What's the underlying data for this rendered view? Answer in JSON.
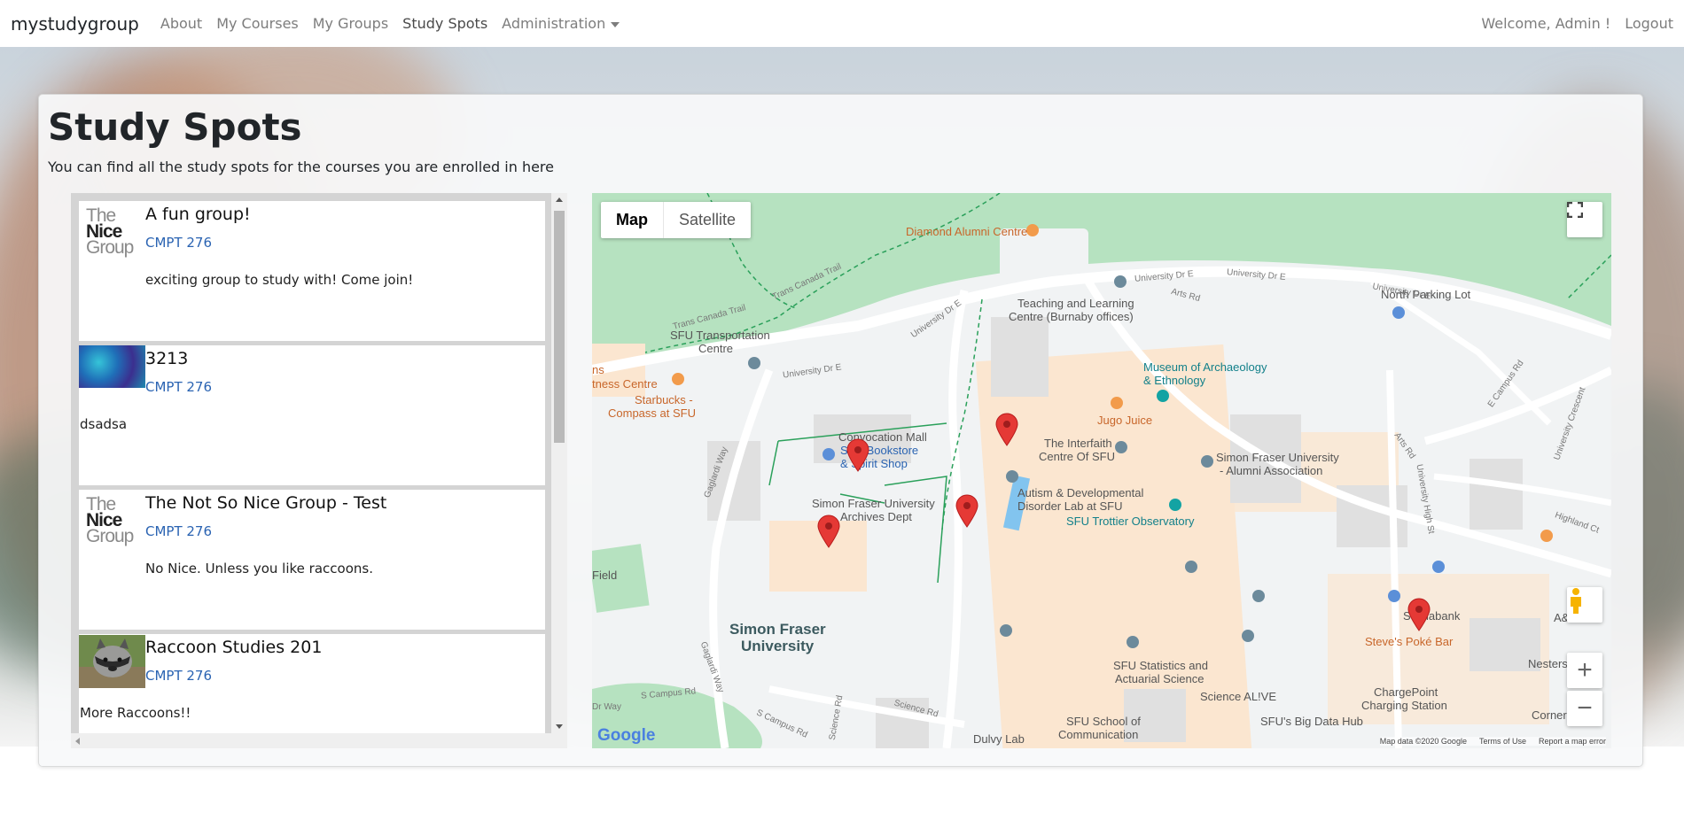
{
  "navbar": {
    "brand": "mystudygroup",
    "links": [
      "About",
      "My Courses",
      "My Groups",
      "Study Spots",
      "Administration"
    ],
    "welcome": "Welcome, Admin !",
    "logout": "Logout"
  },
  "page": {
    "title": "Study Spots",
    "subtitle": "You can find all the study spots for the courses you are enrolled in here"
  },
  "groups": [
    {
      "name": "A fun group!",
      "course": "CMPT 276",
      "description": "exciting group to study with! Come join!",
      "image": "the-nice-group-logo"
    },
    {
      "name": "3213",
      "course": "CMPT 276",
      "description": "dsadsa",
      "image": "blue-abstract-image"
    },
    {
      "name": "The Not So Nice Group - Test",
      "course": "CMPT 276",
      "description": "No Nice. Unless you like raccoons.",
      "image": "the-nice-group-logo"
    },
    {
      "name": "Raccoon Studies 201",
      "course": "CMPT 276",
      "description": "More Raccoons!!",
      "image": "raccoon-photo"
    }
  ],
  "logo_text": {
    "line1": "The",
    "line2": "Nice",
    "line3": "Group"
  },
  "map": {
    "type_buttons": [
      "Map",
      "Satellite"
    ],
    "selected_type": "Map",
    "labels": {
      "diamond": "Diamond Alumni Centre",
      "teaching": "Teaching and Learning",
      "teaching2": "Centre (Burnaby offices)",
      "north_parking": "North Parking Lot",
      "sfu_transport": "SFU Transportation",
      "sfu_transport2": "Centre",
      "museum": "Museum of Archaeology",
      "museum2": "& Ethnology",
      "fitness": "tness Centre",
      "ns": "ns",
      "starbucks": "Starbucks -",
      "starbucks2": "Compass at SFU",
      "convocation": "Convocation Mall",
      "bookstore": "SFU Bookstore",
      "bookstore2": "& Spirit Shop",
      "jugo": "Jugo Juice",
      "interfaith": "The Interfaith",
      "interfaith2": "Centre Of SFU",
      "alumni_assoc": "Simon Fraser University",
      "alumni_assoc2": "- Alumni Association",
      "archives": "Simon Fraser University",
      "archives2": "Archives Dept",
      "autism": "Autism & Developmental",
      "autism2": "Disorder Lab at SFU",
      "trottier": "SFU Trottier Observatory",
      "field": "Field",
      "sfu_big": "Simon Fraser",
      "sfu_big2": "University",
      "scotiabank": "Scotiabank",
      "steves": "Steve's Poké Bar",
      "aw": "A&W Ca",
      "nesters": "Nesters Ma",
      "stats": "SFU Statistics and",
      "stats2": "Actuarial Science",
      "science_alive": "Science AL!VE",
      "big_data": "SFU's Big Data Hub",
      "chargepoint": "ChargePoint",
      "chargepoint2": "Charging Station",
      "communication": "SFU School of",
      "communication2": "Communication",
      "dulvy": "Dulvy Lab",
      "corner": "Corner"
    },
    "roads": {
      "trans_canada": "Trans Canada Trail",
      "trans_canada2": "Trans Canada Trail",
      "univ_dr_e1": "University Dr E",
      "univ_dr_e2": "University Dr E",
      "univ_dr_e3": "University Dr E",
      "univ_dr_e4": "University Dr E",
      "univ_dr_e5": "University Dr E",
      "arts_rd": "Arts Rd",
      "arts_rd2": "Arts Rd",
      "e_campus": "E Campus Rd",
      "univ_crescent": "University Crescent",
      "univ_high": "University High St",
      "highland": "Highland Ct",
      "gaglardi": "Gaglardi Way",
      "gaglardi2": "Gaglardi Way",
      "s_campus": "S Campus Rd",
      "s_campus2": "S Campus Rd",
      "science_rd": "Science Rd",
      "science_rd2": "Science Rd",
      "dr_way": "Dr Way"
    },
    "google_logo": "Google",
    "attribution": [
      "Map data ©2020 Google",
      "Terms of Use",
      "Report a map error"
    ],
    "zoom_in": "+",
    "zoom_out": "−",
    "marker_color": "#e53935"
  },
  "colors": {
    "map_green": "#b6e2c0",
    "map_building_tan": "#fbe6d0",
    "map_road": "#ffffff",
    "link_blue": "#2a63b2"
  }
}
